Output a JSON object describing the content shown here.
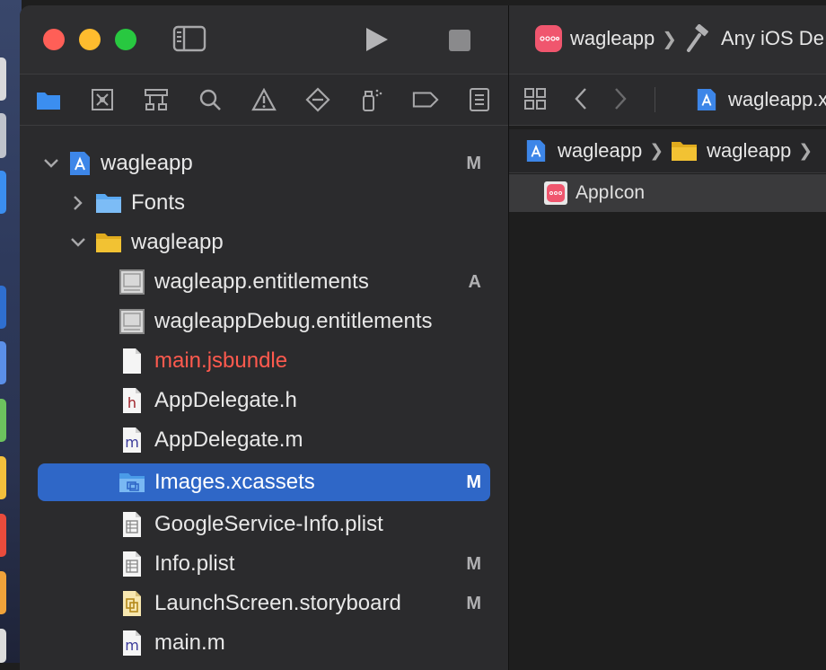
{
  "toolbar": {
    "scheme": "wagleapp",
    "destination": "Any iOS De",
    "separator": "❯"
  },
  "editor_tab": {
    "file": "wagleapp.x"
  },
  "jumpbar": {
    "project": "wagleapp",
    "group": "wagleapp",
    "separator": "❯"
  },
  "asset": {
    "name": "AppIcon"
  },
  "tree": {
    "project": {
      "label": "wagleapp",
      "badge": "M"
    },
    "fonts": {
      "label": "Fonts"
    },
    "group": {
      "label": "wagleapp"
    },
    "files": [
      {
        "label": "wagleapp.entitlements",
        "badge": "A",
        "icon": "entitlements-icon"
      },
      {
        "label": "wagleappDebug.entitlements",
        "badge": "",
        "icon": "entitlements-icon"
      },
      {
        "label": "main.jsbundle",
        "badge": "",
        "icon": "blank-file-icon"
      },
      {
        "label": "AppDelegate.h",
        "badge": "",
        "icon": "header-file-icon"
      },
      {
        "label": "AppDelegate.m",
        "badge": "",
        "icon": "objc-file-icon"
      },
      {
        "label": "Images.xcassets",
        "badge": "M",
        "icon": "asset-catalog-icon"
      },
      {
        "label": "GoogleService-Info.plist",
        "badge": "",
        "icon": "plist-icon"
      },
      {
        "label": "Info.plist",
        "badge": "M",
        "icon": "plist-icon"
      },
      {
        "label": "LaunchScreen.storyboard",
        "badge": "M",
        "icon": "storyboard-icon"
      },
      {
        "label": "main.m",
        "badge": "",
        "icon": "objc-file-icon"
      }
    ]
  },
  "colors": {
    "selection": "#2f67c7",
    "missing_file_text": "#ff5a4e",
    "folder_blue": "#5aa9f2",
    "folder_yellow": "#f2c233",
    "app_icon_pink": "#f0566e"
  },
  "icons": {
    "h_letter": "h",
    "m_letter": "m"
  }
}
